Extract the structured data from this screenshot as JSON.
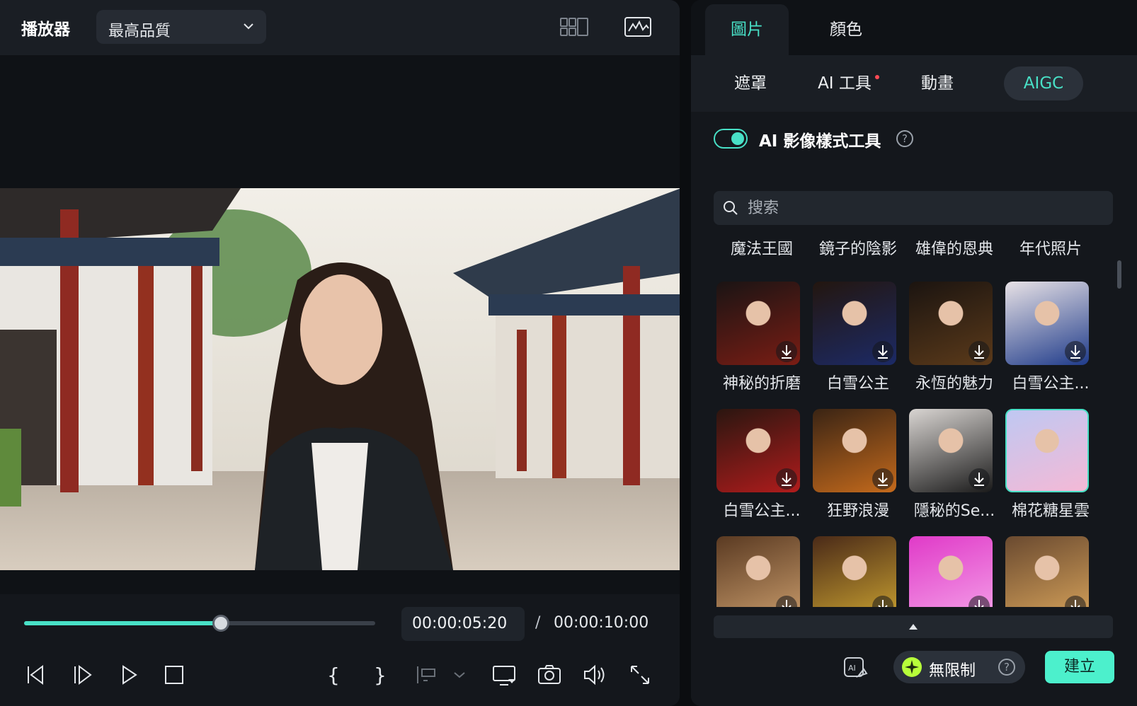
{
  "player": {
    "title": "播放器",
    "quality": "最高品質",
    "current_time": "00:00:05:20",
    "separator": "/",
    "total_time": "00:00:10:00",
    "progress_fraction": 0.56
  },
  "panel": {
    "top_tabs": [
      {
        "label": "圖片",
        "active": true
      },
      {
        "label": "顏色",
        "active": false
      }
    ],
    "sub_tabs": [
      {
        "label": "遮罩",
        "active": false
      },
      {
        "label": "AI 工具",
        "active": false,
        "dot": true
      },
      {
        "label": "動畫",
        "active": false
      },
      {
        "label": "AIGC",
        "active": true
      }
    ],
    "tool_title": "AI 影像樣式工具",
    "toggle_on": true,
    "search_placeholder": "搜索",
    "styles": [
      "魔法王國",
      "鏡子的陰影",
      "雄偉的恩典",
      "年代照片",
      "神秘的折磨",
      "白雪公主",
      "永恆的魅力",
      "白雪公主...",
      "白雪公主...",
      "狂野浪漫",
      "隱秘的Se...",
      "棉花糖星雲"
    ],
    "selected_style": "棉花糖星雲",
    "unlimited_label": "無限制",
    "create_label": "建立"
  },
  "colors": {
    "accent": "#48e0c6",
    "button": "#4cf0cc",
    "badge": "#b7ff3a",
    "dot": "#ff4a55"
  }
}
